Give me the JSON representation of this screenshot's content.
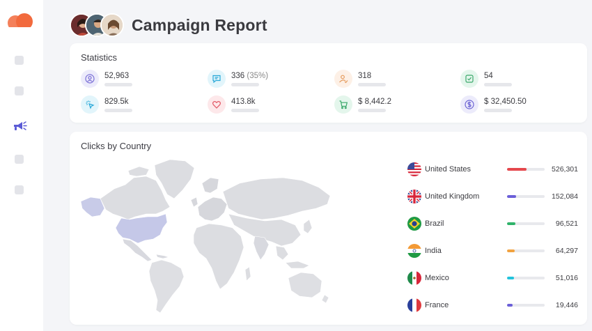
{
  "header": {
    "title": "Campaign Report",
    "avatars": [
      "avatar-1",
      "avatar-2",
      "avatar-3"
    ]
  },
  "sidebar": {
    "active_icon": "megaphone-icon",
    "accent": "#5b5bd6",
    "logo_color": "#f26a3d"
  },
  "statistics": {
    "title": "Statistics",
    "items": [
      {
        "icon": "user-circle-icon",
        "value": "52,963",
        "sub": "",
        "color": "#7a6fd6",
        "bg": "#ecebfb"
      },
      {
        "icon": "message-icon",
        "value": "336",
        "sub": "(35%)",
        "color": "#28a8d8",
        "bg": "#e2f5fb"
      },
      {
        "icon": "user-check-icon",
        "value": "318",
        "sub": "",
        "color": "#e59a5b",
        "bg": "#fdf0e6"
      },
      {
        "icon": "check-square-icon",
        "value": "54",
        "sub": "",
        "color": "#3aa86a",
        "bg": "#e4f6ec"
      },
      {
        "icon": "click-icon",
        "value": "829.5k",
        "sub": "",
        "color": "#28a8d8",
        "bg": "#e2f5fb"
      },
      {
        "icon": "heart-icon",
        "value": "413.8k",
        "sub": "",
        "color": "#e25563",
        "bg": "#fde8ea"
      },
      {
        "icon": "cart-icon",
        "value": "$ 8,442.2",
        "sub": "",
        "color": "#3aa86a",
        "bg": "#e4f6ec"
      },
      {
        "icon": "dollar-icon",
        "value": "$ 32,450.50",
        "sub": "",
        "color": "#6d64d4",
        "bg": "#ecebfb"
      }
    ]
  },
  "clicks_by_country": {
    "title": "Clicks by Country",
    "countries": [
      {
        "name": "United States",
        "value": "526,301",
        "fraction": 0.52,
        "color": "#e5484d",
        "flag": "us-flag-icon"
      },
      {
        "name": "United Kingdom",
        "value": "152,084",
        "fraction": 0.24,
        "color": "#6b5fd8",
        "flag": "uk-flag-icon"
      },
      {
        "name": "Brazil",
        "value": "96,521",
        "fraction": 0.22,
        "color": "#2fb36a",
        "flag": "brazil-flag-icon"
      },
      {
        "name": "India",
        "value": "64,297",
        "fraction": 0.2,
        "color": "#f2a340",
        "flag": "india-flag-icon"
      },
      {
        "name": "Mexico",
        "value": "51,016",
        "fraction": 0.19,
        "color": "#22c3dc",
        "flag": "mexico-flag-icon"
      },
      {
        "name": "France",
        "value": "19,446",
        "fraction": 0.14,
        "color": "#6b5fd8",
        "flag": "france-flag-icon"
      }
    ]
  }
}
